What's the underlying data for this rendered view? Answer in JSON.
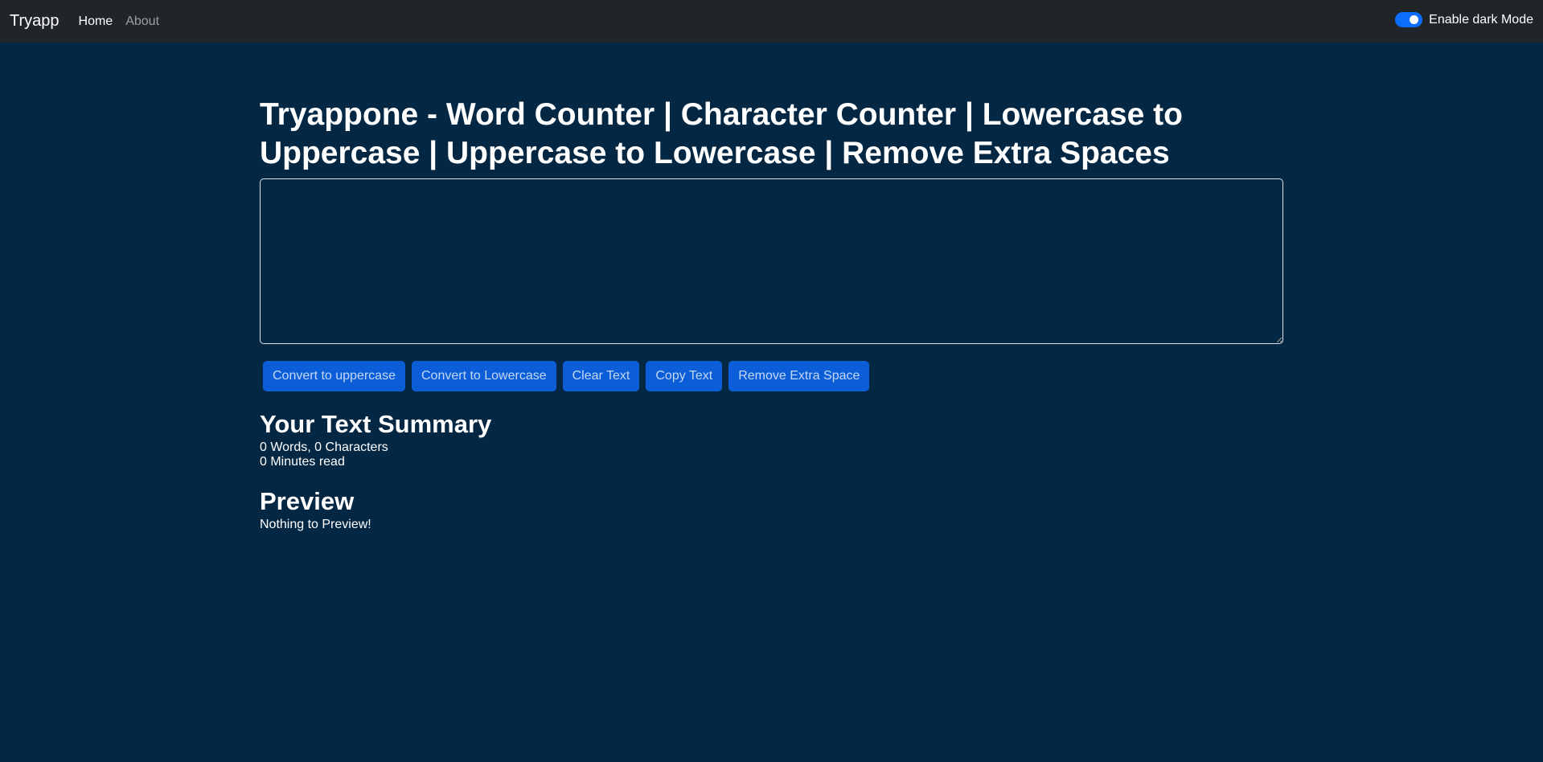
{
  "navbar": {
    "brand": "Tryapp",
    "links": [
      {
        "label": "Home"
      },
      {
        "label": "About"
      }
    ],
    "dark_mode_label": "Enable dark Mode",
    "dark_mode_enabled": true
  },
  "main": {
    "title": "Tryappone - Word Counter | Character Counter | Lowercase to Uppercase | Uppercase to Lowercase | Remove Extra Spaces",
    "textarea_value": "",
    "buttons": [
      {
        "label": "Convert to uppercase"
      },
      {
        "label": "Convert to Lowercase"
      },
      {
        "label": "Clear Text"
      },
      {
        "label": "Copy Text"
      },
      {
        "label": "Remove Extra Space"
      }
    ]
  },
  "summary": {
    "title": "Your Text Summary",
    "words_chars": "0 Words, 0 Characters",
    "minutes_read": "0 Minutes read"
  },
  "preview": {
    "title": "Preview",
    "text": "Nothing to Preview!"
  },
  "colors": {
    "background": "#042743",
    "navbar": "#212529",
    "accent": "#0d6efd"
  }
}
